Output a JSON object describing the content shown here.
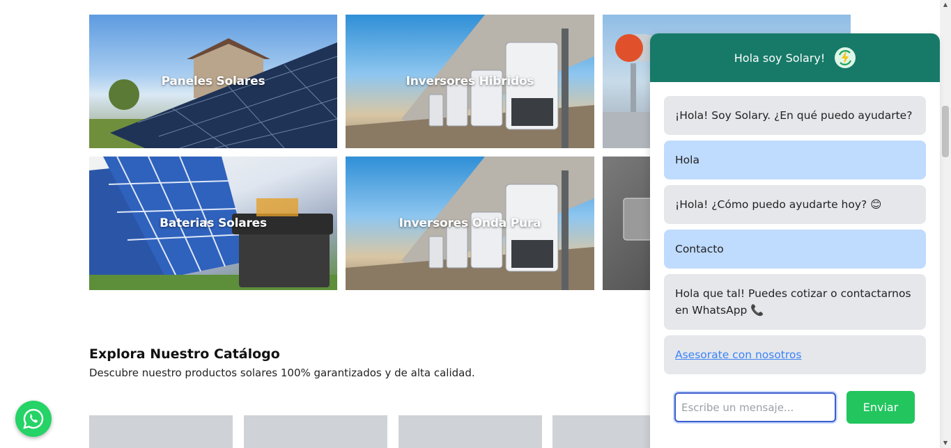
{
  "categories": [
    {
      "label": "Paneles Solares"
    },
    {
      "label": "Inversores Hibridos"
    },
    {
      "label": "Baterias Solares"
    },
    {
      "label": "Inversores Onda Pura"
    }
  ],
  "catalog": {
    "title": "Explora Nuestro Catálogo",
    "subtitle": "Descubre nuestro productos solares 100% garantizados y de alta calidad."
  },
  "chat": {
    "header_title": "Hola soy Solary!",
    "header_icon": "bolt-recycle-icon",
    "messages": [
      {
        "role": "bot",
        "text": "¡Hola! Soy Solary. ¿En qué puedo ayudarte?"
      },
      {
        "role": "user",
        "text": "Hola"
      },
      {
        "role": "bot",
        "text": "¡Hola! ¿Cómo puedo ayudarte hoy? 😊"
      },
      {
        "role": "user",
        "text": "Contacto"
      },
      {
        "role": "bot",
        "text": "Hola que tal! Puedes cotizar o contactarnos en WhatsApp 📞"
      },
      {
        "role": "bot",
        "text": "Asesorate con nosotros"
      }
    ],
    "input_placeholder": "Escribe un mensaje...",
    "send_label": "Enviar"
  },
  "colors": {
    "chat_header": "#177a68",
    "send_button": "#22c55e",
    "user_bubble": "#bfdbfe",
    "bot_bubble": "#e5e7eb",
    "whatsapp": "#25d366"
  }
}
